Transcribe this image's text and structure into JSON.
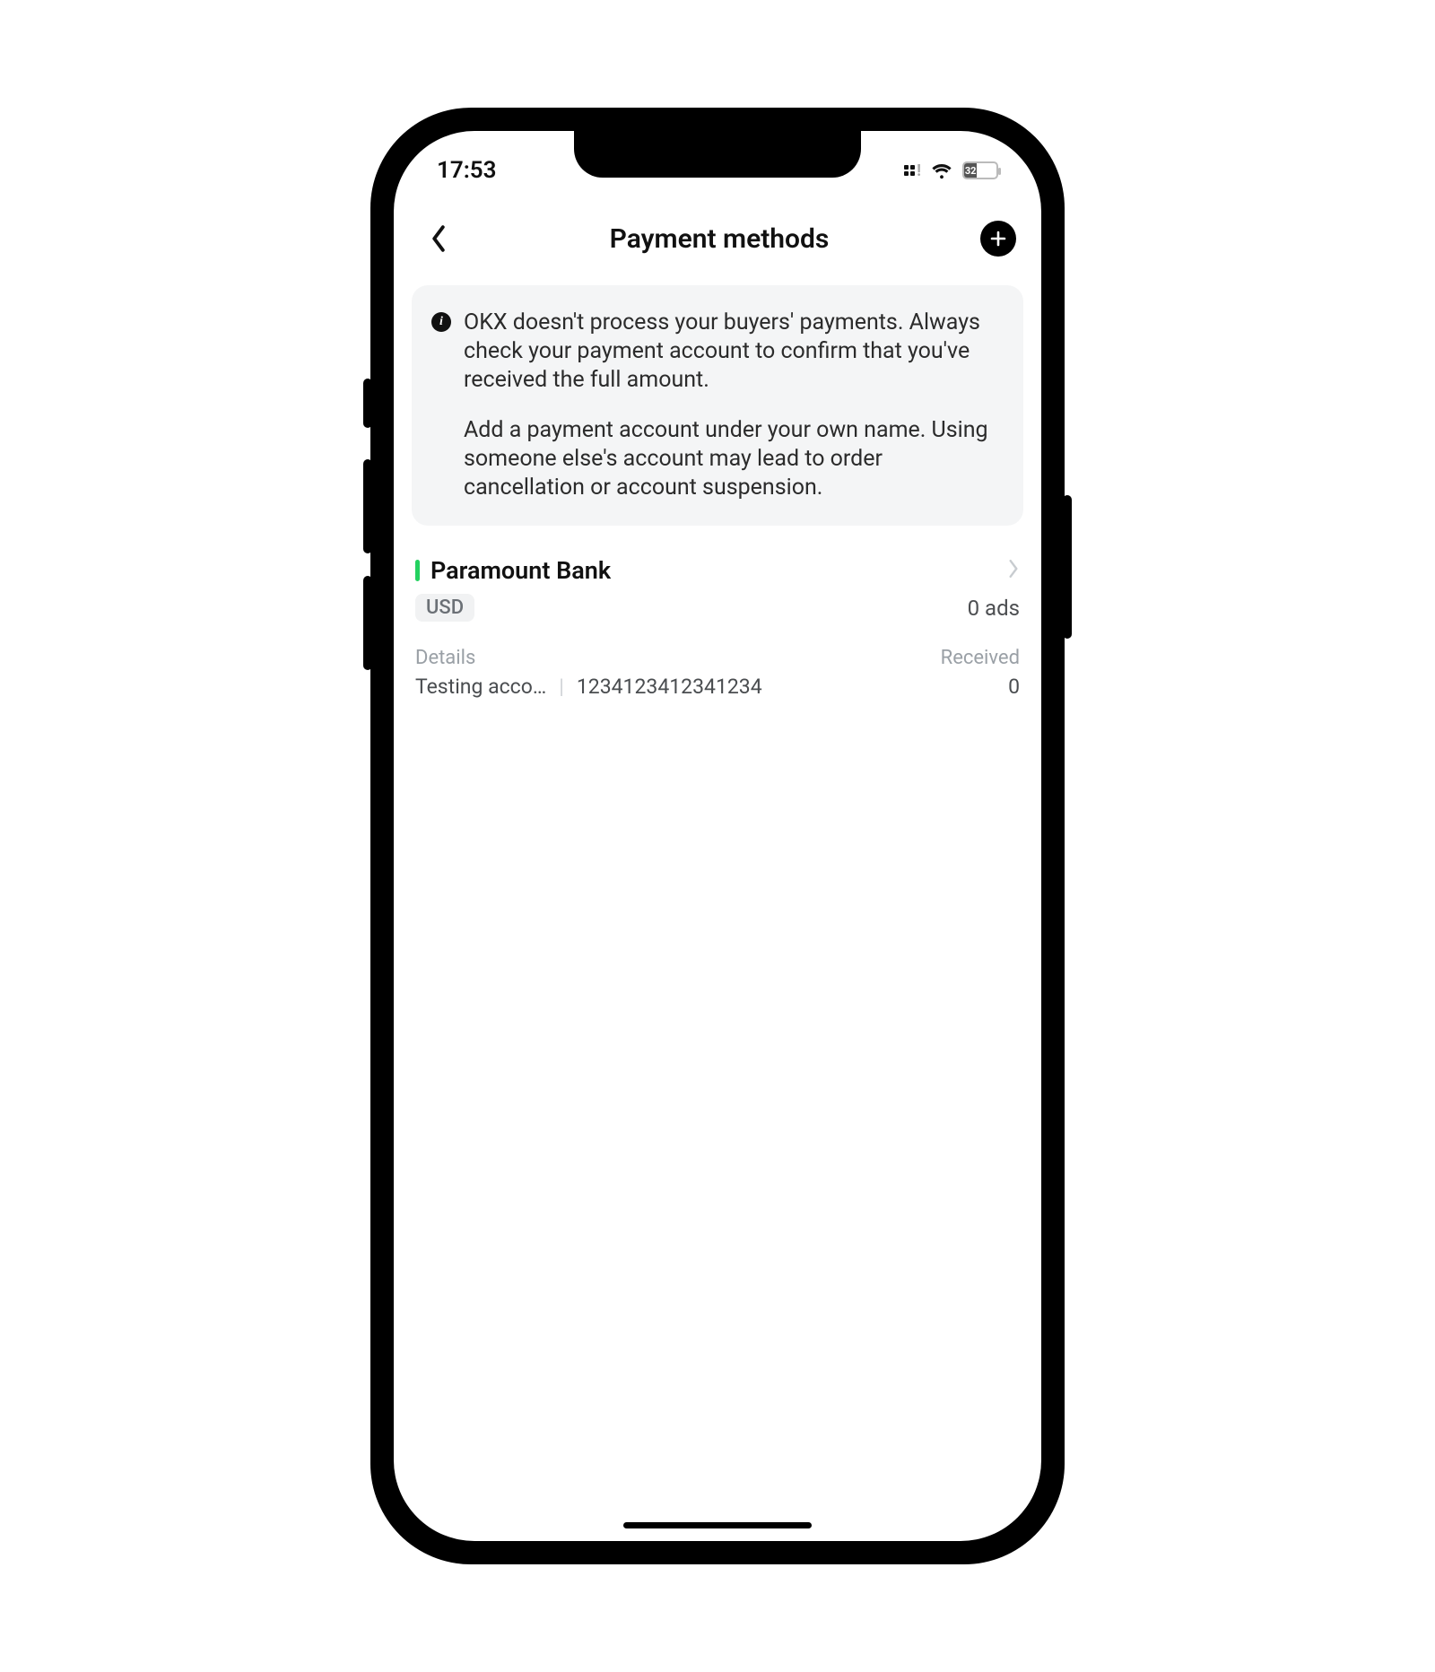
{
  "status": {
    "time": "17:53",
    "battery_pct": "32"
  },
  "header": {
    "title": "Payment methods"
  },
  "notice": {
    "p1": "OKX doesn't process your buyers' payments. Always check your payment account to confirm that you've received the full amount.",
    "p2": "Add a payment account under your own name. Using someone else's account may lead to order cancellation or account suspension."
  },
  "method": {
    "name": "Paramount Bank",
    "currency": "USD",
    "ads": "0 ads",
    "details_label": "Details",
    "received_label": "Received",
    "account_name": "Testing acco…",
    "account_number": "1234123412341234",
    "received_value": "0",
    "accent_color": "#24d160"
  }
}
